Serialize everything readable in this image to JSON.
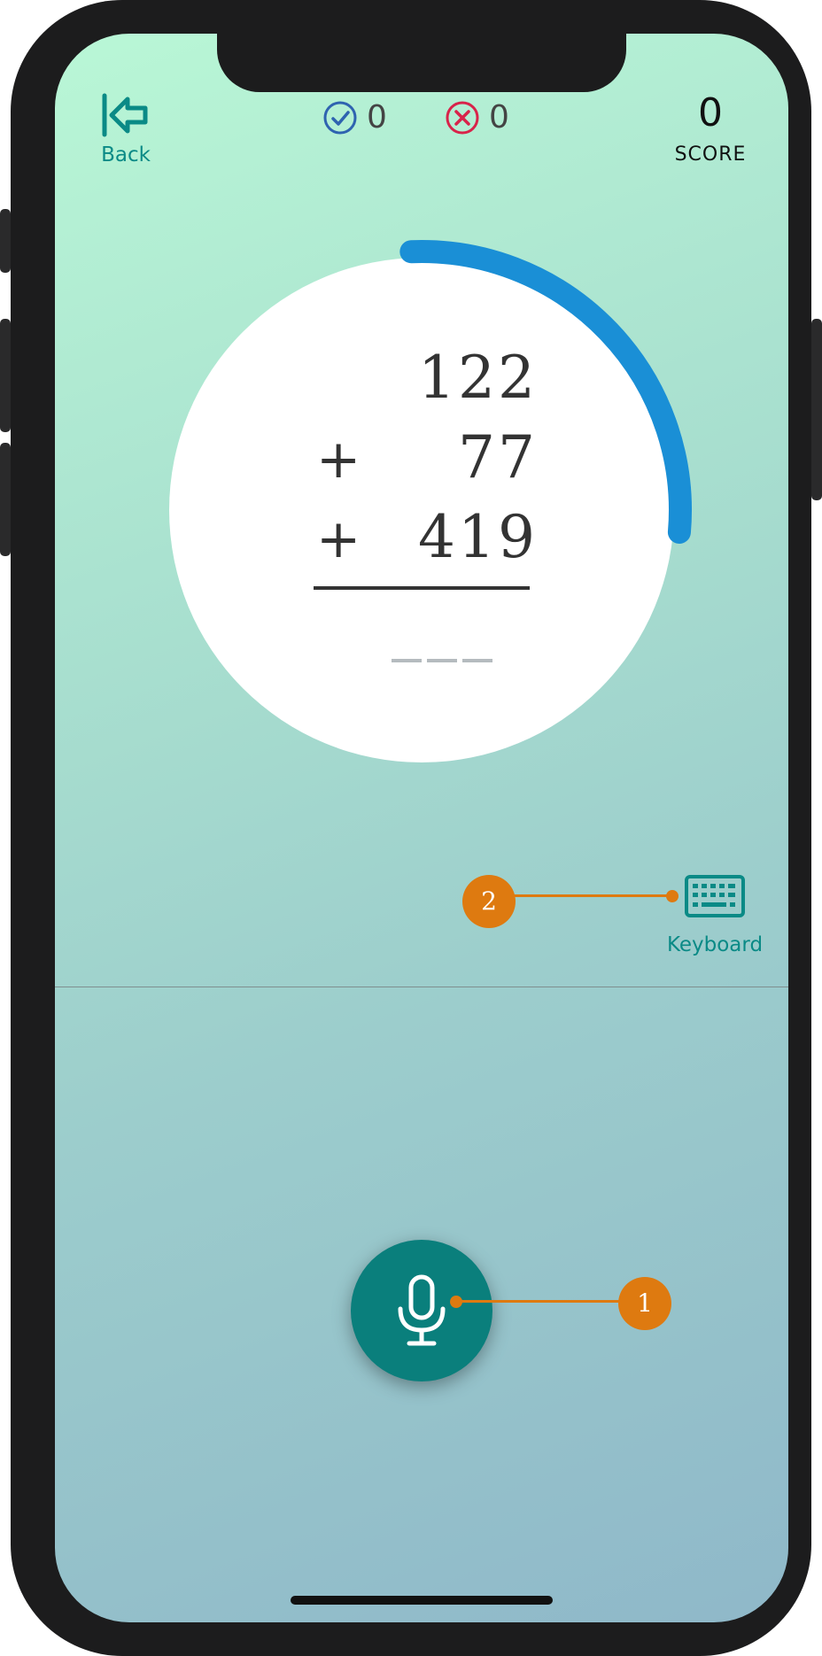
{
  "header": {
    "back_label": "Back",
    "correct_count": "0",
    "wrong_count": "0",
    "score_value": "0",
    "score_label": "SCORE"
  },
  "problem": {
    "row1": {
      "operator": "",
      "value": "122"
    },
    "row2": {
      "operator": "+",
      "value": "77"
    },
    "row3": {
      "operator": "+",
      "value": "419"
    },
    "answer_slots": 3,
    "timer_progress": 0.27
  },
  "controls": {
    "keyboard_label": "Keyboard"
  },
  "callouts": [
    {
      "number": "1"
    },
    {
      "number": "2"
    }
  ],
  "colors": {
    "accent": "#0a8a86",
    "timer": "#1a8fd6",
    "correct": "#2e63b0",
    "wrong": "#d8234a",
    "callout": "#de7a10",
    "mic": "#0a7f7c"
  },
  "icons": {
    "back": "back-arrow-icon",
    "correct": "check-circle-icon",
    "wrong": "x-circle-icon",
    "keyboard": "keyboard-icon",
    "mic": "microphone-icon"
  }
}
